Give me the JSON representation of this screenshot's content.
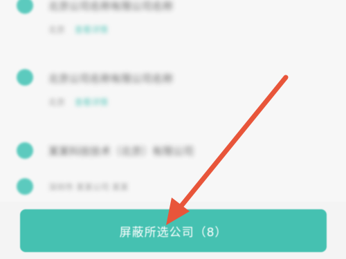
{
  "list": {
    "items": [
      {
        "name": "北京公司名称有限公司名称",
        "tag": "北京",
        "link": "查看详情"
      },
      {
        "name": "北京公司名称有限公司名称",
        "tag": "北京",
        "link": "查看详情"
      },
      {
        "name": "某某科技技术（北京）有限公司",
        "meta": "深圳市 某某公司 某某"
      }
    ]
  },
  "footer": {
    "block_label": "屏蔽所选公司（8）"
  },
  "colors": {
    "accent": "#45c1b1",
    "annotation_arrow": "#e8553a"
  }
}
